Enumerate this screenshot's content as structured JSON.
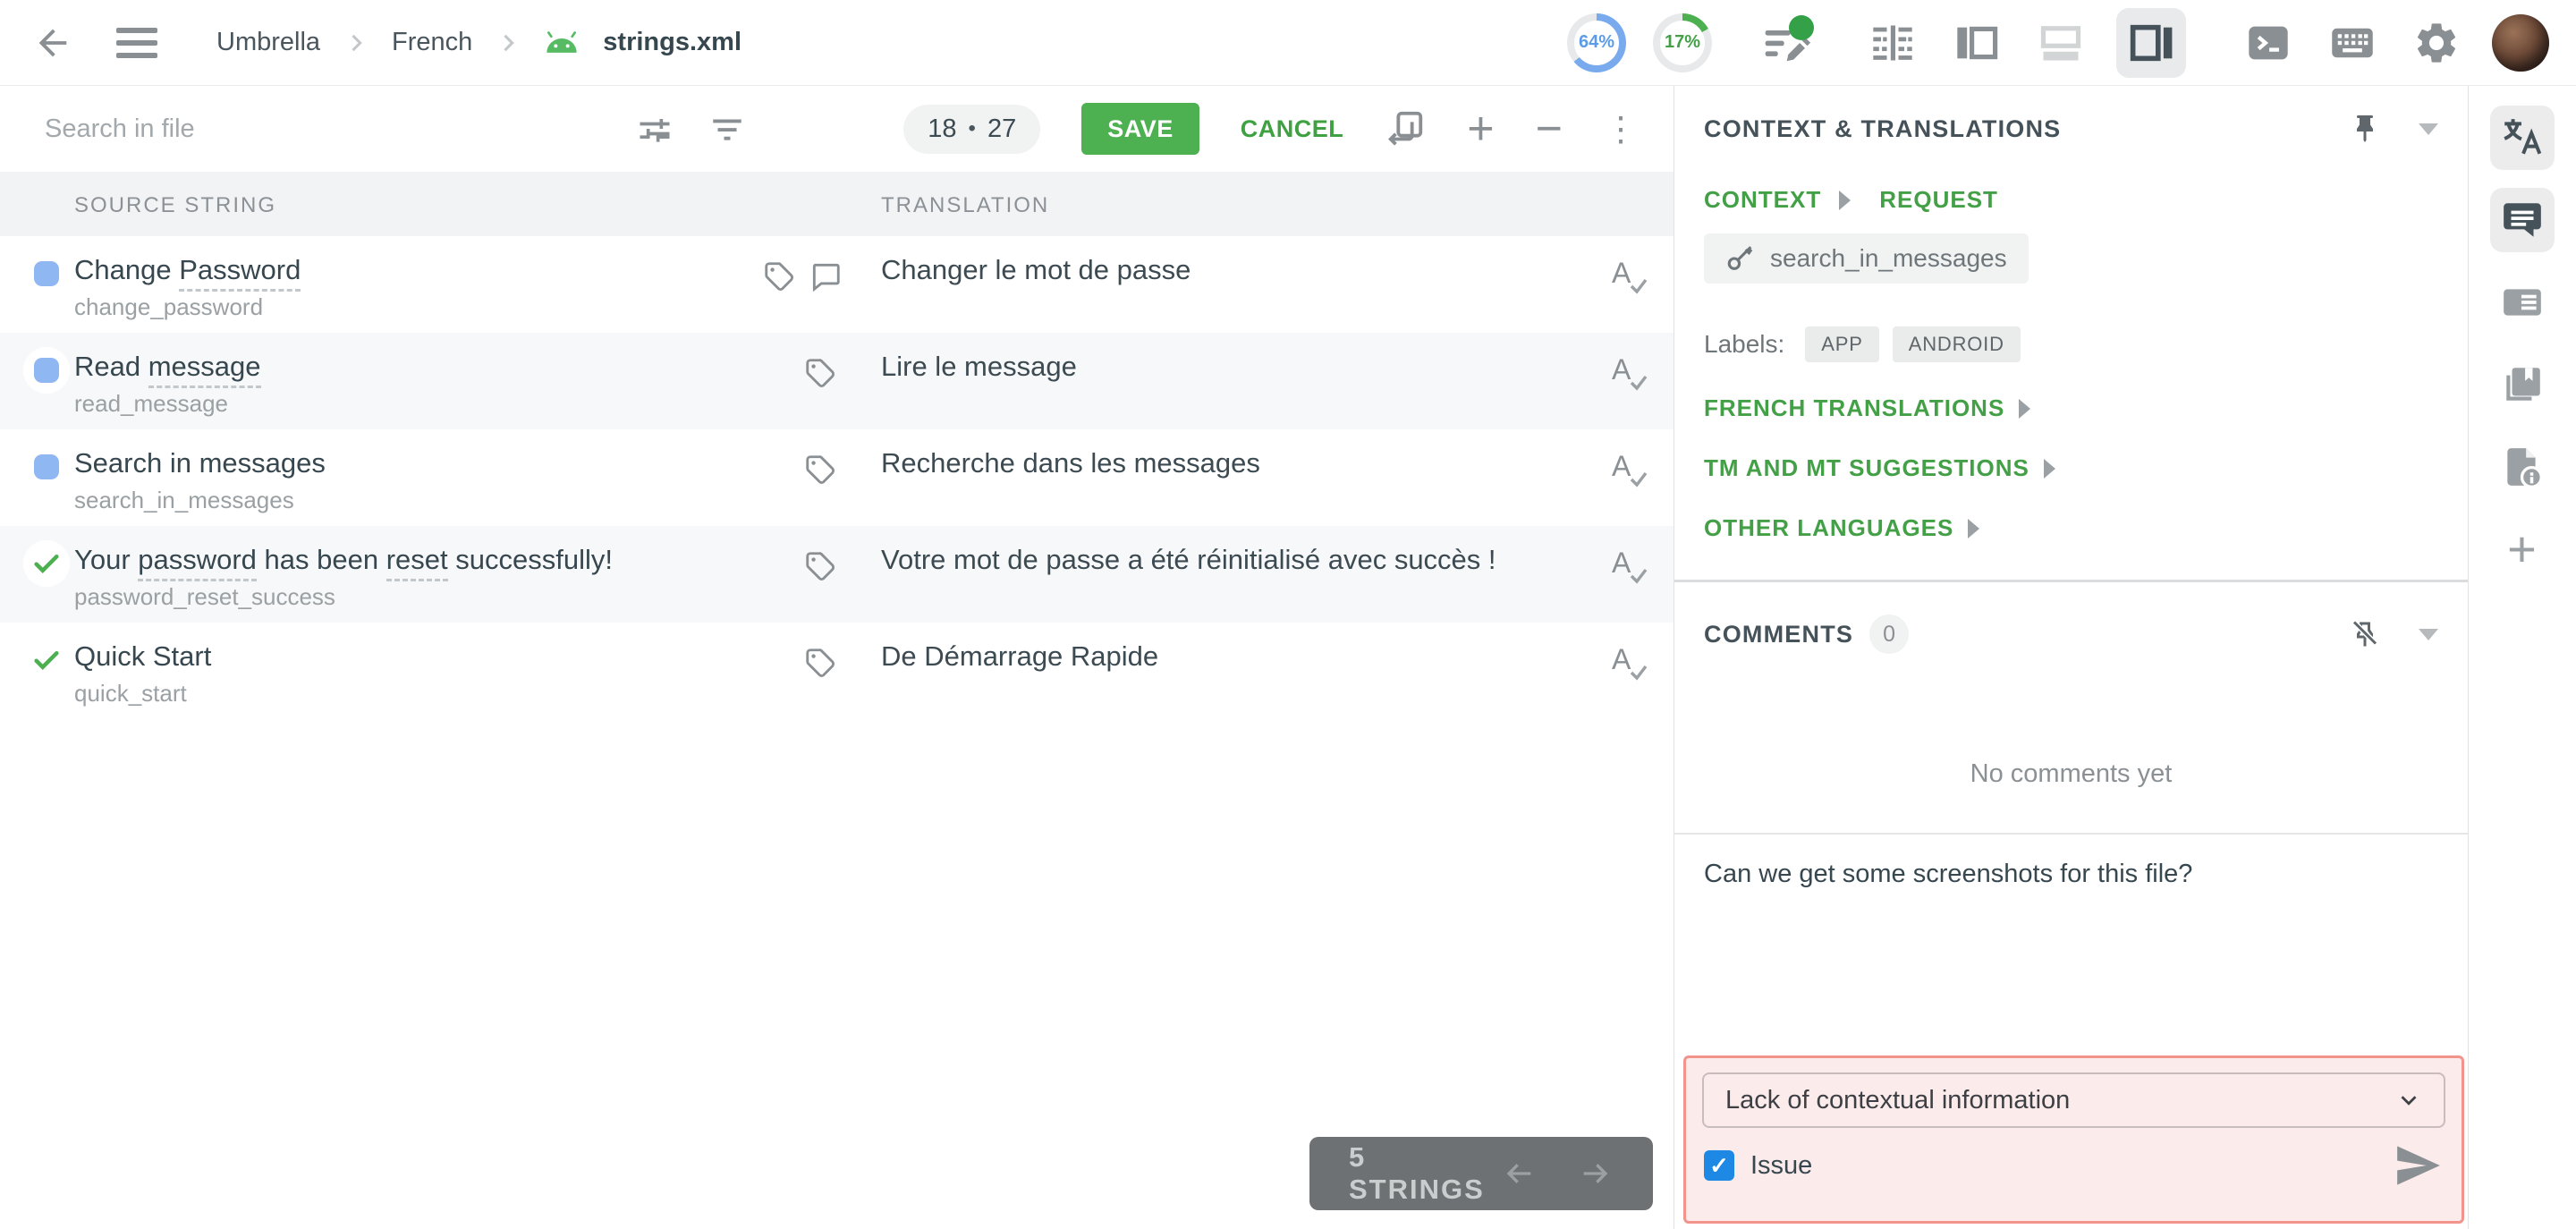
{
  "topbar": {
    "project": "Umbrella",
    "language": "French",
    "file_name": "strings.xml",
    "translated_pct": "64%",
    "approved_pct": "17%"
  },
  "toolbar": {
    "search_placeholder": "Search in file",
    "position": "18",
    "dot": "•",
    "total": "27",
    "save_label": "SAVE",
    "cancel_label": "CANCEL"
  },
  "table": {
    "source_header": "SOURCE STRING",
    "translation_header": "TRANSLATION",
    "rows": [
      {
        "p0": "Change ",
        "p1": "Password",
        "key": "change_password",
        "translation": "Changer le mot de passe",
        "status": "untranslated"
      },
      {
        "p0": "Read ",
        "p1": "message",
        "key": "read_message",
        "translation": "Lire le message",
        "status": "untranslated"
      },
      {
        "p0": "Search in messages",
        "key": "search_in_messages",
        "translation": "Recherche dans les messages",
        "status": "untranslated"
      },
      {
        "p0": "Your ",
        "p1": "password",
        "p2": " has been ",
        "p3": "reset",
        "p4": " successfully!",
        "key": "password_reset_success",
        "translation": "Votre mot de passe a été réinitialisé avec succès !",
        "status": "approved"
      },
      {
        "p0": "Quick Start",
        "key": "quick_start",
        "translation": "De Démarrage Rapide",
        "status": "approved"
      }
    ]
  },
  "footer": {
    "strings_label": "5 STRINGS"
  },
  "context_panel": {
    "title": "CONTEXT & TRANSLATIONS",
    "context_tab": "CONTEXT",
    "request_tab": "REQUEST",
    "string_key": "search_in_messages",
    "labels_title": "Labels:",
    "labels": [
      "APP",
      "ANDROID"
    ],
    "sections": [
      "FRENCH TRANSLATIONS",
      "TM AND MT SUGGESTIONS",
      "OTHER LANGUAGES"
    ]
  },
  "comments_panel": {
    "title": "COMMENTS",
    "count": "0",
    "empty_text": "No comments yet",
    "draft_text": "Can we get some screenshots for this file?"
  },
  "issue_box": {
    "type_selected": "Lack of contextual information",
    "checkbox_label": "Issue",
    "checked": true,
    "checkmark": "✓"
  },
  "colors": {
    "accent_green": "#43a047",
    "save_green": "#4db151",
    "progress_blue": "#5b9ce6",
    "row_indicator_blue": "#8fb7f2",
    "approved_green": "#4caf50",
    "issue_border": "#f2938c",
    "issue_bg": "#fcebeb",
    "checkbox_blue": "#1e88e5"
  }
}
